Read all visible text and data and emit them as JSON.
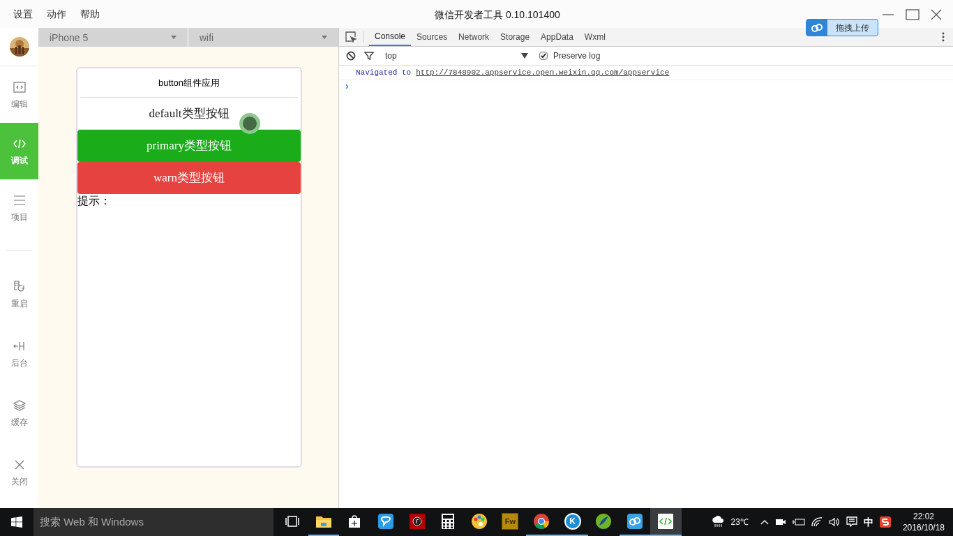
{
  "window": {
    "title": "微信开发者工具 0.10.101400",
    "menu": [
      "设置",
      "动作",
      "帮助"
    ],
    "upload_button": "拖拽上传"
  },
  "sidebar": {
    "items": [
      {
        "label": "编辑",
        "selected": false
      },
      {
        "label": "调试",
        "selected": true
      },
      {
        "label": "项目",
        "selected": false
      },
      {
        "label": "重启",
        "selected": false
      },
      {
        "label": "后台",
        "selected": false
      },
      {
        "label": "缓存",
        "selected": false
      },
      {
        "label": "关闭",
        "selected": false
      }
    ]
  },
  "simulator": {
    "device": "iPhone 5",
    "network": "wifi",
    "page_title": "button组件应用",
    "buttons": [
      {
        "label": "default类型按钮",
        "kind": "default"
      },
      {
        "label": "primary类型按钮",
        "kind": "primary"
      },
      {
        "label": "warn类型按钮",
        "kind": "warn"
      }
    ],
    "hint": "提示："
  },
  "devtools": {
    "tabs": [
      {
        "label": "Console",
        "selected": true
      },
      {
        "label": "Sources",
        "selected": false
      },
      {
        "label": "Network",
        "selected": false
      },
      {
        "label": "Storage",
        "selected": false
      },
      {
        "label": "AppData",
        "selected": false
      },
      {
        "label": "Wxml",
        "selected": false
      }
    ],
    "context": "top",
    "preserve_log": {
      "label": "Preserve log",
      "checked": true
    },
    "console": {
      "message": "Navigated to",
      "link": "http://7848902.appservice.open.weixin.qq.com/appservice",
      "prompt": "›"
    }
  },
  "taskbar": {
    "search_placeholder": "搜索 Web 和 Windows",
    "apps": [
      {
        "kind": "taskview",
        "running": false,
        "selected": false
      },
      {
        "kind": "folder",
        "running": true,
        "selected": false
      },
      {
        "kind": "store",
        "running": false,
        "selected": false
      },
      {
        "kind": "chat",
        "running": false,
        "selected": false
      },
      {
        "kind": "music",
        "running": false,
        "selected": false
      },
      {
        "kind": "calculator",
        "running": false,
        "selected": false
      },
      {
        "kind": "palette",
        "running": false,
        "selected": false
      },
      {
        "kind": "fw",
        "label": "Fw",
        "running": false,
        "selected": false
      },
      {
        "kind": "chrome",
        "running": true,
        "selected": false
      },
      {
        "kind": "k",
        "label": "K",
        "running": true,
        "selected": false
      },
      {
        "kind": "editor",
        "running": false,
        "selected": false
      },
      {
        "kind": "cloud",
        "running": true,
        "selected": false
      },
      {
        "kind": "devtool",
        "running": true,
        "selected": true
      }
    ],
    "temperature": "23℃",
    "ime": "中",
    "time": "22:02",
    "date": "2016/10/18"
  }
}
